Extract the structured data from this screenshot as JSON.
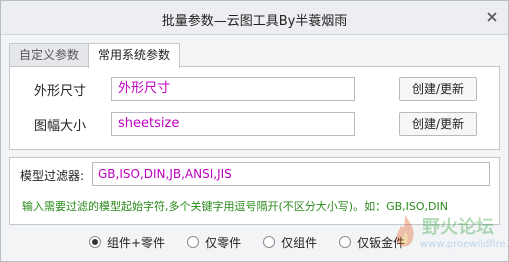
{
  "window": {
    "title": "批量参数—云图工具By半蓑烟雨"
  },
  "tabs": [
    {
      "label": "自定义参数",
      "active": false
    },
    {
      "label": "常用系统参数",
      "active": true
    }
  ],
  "rows": [
    {
      "label": "外形尺寸",
      "value": "外形尺寸",
      "button": "创建/更新"
    },
    {
      "label": "图幅大小",
      "value": "sheetsize",
      "button": "创建/更新"
    }
  ],
  "filter": {
    "label": "模型过滤器:",
    "value": "GB,ISO,DIN,JB,ANSI,JIS",
    "hint": "输入需要过滤的模型起始字符,多个关键字用逗号隔开(不区分大小写)。如：GB,ISO,DIN"
  },
  "radios": [
    {
      "label": "组件+零件",
      "selected": true
    },
    {
      "label": "仅零件",
      "selected": false
    },
    {
      "label": "仅组件",
      "selected": false
    },
    {
      "label": "仅钣金件",
      "selected": false
    }
  ],
  "watermark": {
    "text": "野火论坛",
    "url": "www.proewildfire.cn"
  },
  "colors": {
    "value_text": "#c000c0",
    "hint_text": "#2a8a1a"
  }
}
